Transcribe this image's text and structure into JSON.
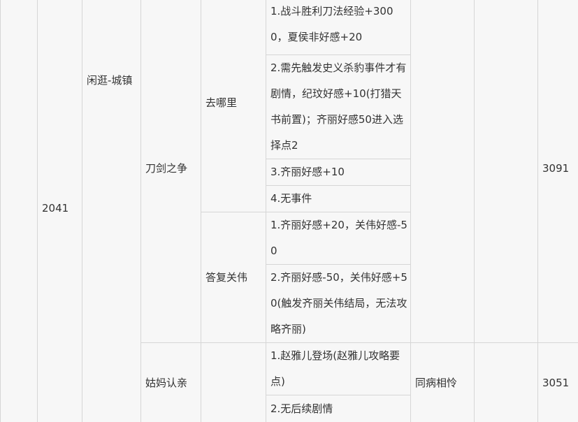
{
  "row": {
    "id": "2041",
    "location": "闲逛-城镇"
  },
  "events": [
    {
      "name": "刀剑之争",
      "code": "3091",
      "result": "",
      "options": [
        {
          "label": "去哪里",
          "outcomes": [
            "1.战斗胜利刀法经验+3000，夏侯非好感+20",
            "2.需先触发史义杀豹事件才有剧情，纪玟好感+10(打猎天书前置)；齐丽好感50进入选择点2",
            "3.齐丽好感+10",
            "4.无事件"
          ]
        },
        {
          "label": "答复关伟",
          "outcomes": [
            "1.齐丽好感+20，关伟好感-50",
            "2.齐丽好感-50，关伟好感+50(触发齐丽关伟结局，无法攻略齐丽)"
          ]
        }
      ]
    },
    {
      "name": "姑妈认亲",
      "code": "3051",
      "result": "同病相怜",
      "options": [
        {
          "label": "",
          "outcomes": [
            "1.赵雅儿登场(赵雅儿攻略要点)",
            "2.无后续剧情"
          ]
        }
      ]
    }
  ]
}
